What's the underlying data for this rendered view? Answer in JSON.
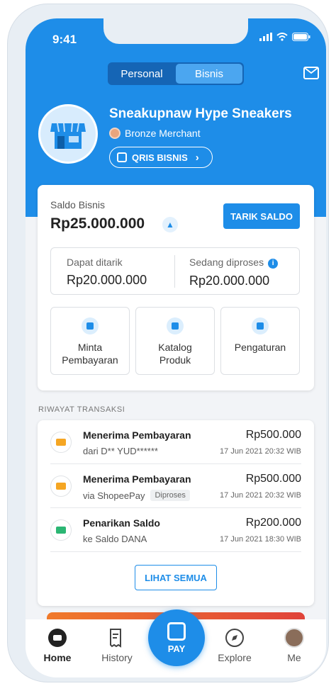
{
  "status": {
    "time": "9:41"
  },
  "toggle": {
    "personal": "Personal",
    "bisnis": "Bisnis"
  },
  "profile": {
    "name": "Sneakupnaw Hype Sneakers",
    "tier": "Bronze Merchant",
    "qris_label": "QRIS BISNIS"
  },
  "saldo": {
    "label": "Saldo Bisnis",
    "amount": "Rp25.000.000",
    "withdraw_label": "TARIK SALDO",
    "dapat_label": "Dapat ditarik",
    "dapat_value": "Rp20.000.000",
    "proses_label": "Sedang diproses",
    "proses_value": "Rp20.000.000"
  },
  "actions": [
    {
      "label": "Minta Pembayaran",
      "icon": "request-payment-icon"
    },
    {
      "label": "Katalog Produk",
      "icon": "catalog-icon"
    },
    {
      "label": "Pengaturan",
      "icon": "store-settings-icon"
    }
  ],
  "history": {
    "title": "RIWAYAT TRANSAKSI",
    "items": [
      {
        "title": "Menerima Pembayaran",
        "sub": "dari D** YUD******",
        "badge": "",
        "amount": "Rp500.000",
        "date": "17 Jun 2021 20:32 WIB",
        "icon_color": "#f5a623"
      },
      {
        "title": "Menerima Pembayaran",
        "sub": "via ShopeePay",
        "badge": "Diproses",
        "amount": "Rp500.000",
        "date": "17 Jun 2021 20:32 WIB",
        "icon_color": "#f5a623"
      },
      {
        "title": "Penarikan Saldo",
        "sub": "ke Saldo DANA",
        "badge": "",
        "amount": "Rp200.000",
        "date": "17 Jun 2021 18:30 WIB",
        "icon_color": "#2bb673"
      }
    ],
    "see_all": "LIHAT SEMUA"
  },
  "nav": {
    "home": "Home",
    "history": "History",
    "pay": "PAY",
    "explore": "Explore",
    "me": "Me"
  },
  "colors": {
    "primary": "#1e8de8",
    "background": "#f2f4f7"
  }
}
